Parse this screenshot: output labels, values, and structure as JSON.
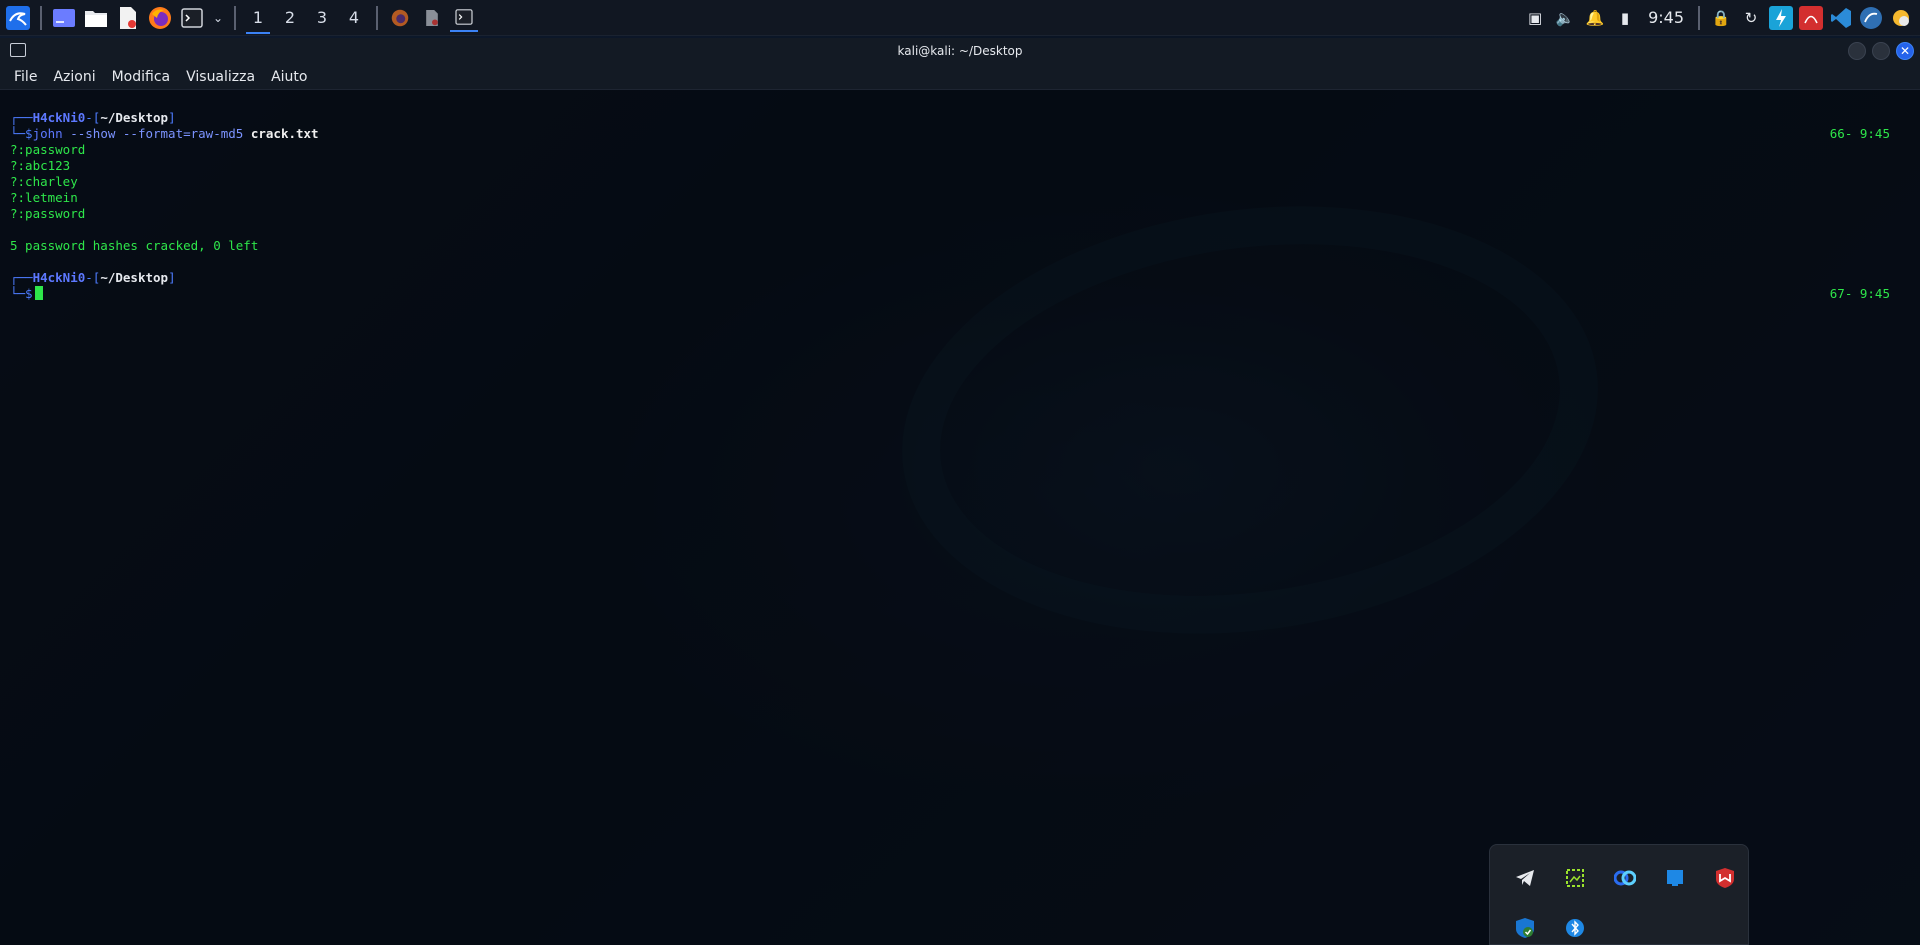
{
  "taskbar": {
    "workspaces": [
      "1",
      "2",
      "3",
      "4"
    ],
    "active_workspace": "1",
    "clock": "9:45",
    "icons_left": [
      "kali-menu-icon",
      "desktop-icon",
      "files-icon",
      "text-editor-icon",
      "firefox-icon",
      "terminal-icon",
      "dropdown-icon"
    ],
    "running_apps": [
      "firefox-icon",
      "text-editor-icon",
      "terminal-icon"
    ],
    "tray_icons": [
      "screen-icon",
      "volume-icon",
      "notifications-icon",
      "battery-icon",
      "lock-icon",
      "refresh-icon",
      "lightning-icon",
      "pdf-icon",
      "vscode-icon",
      "kali-dragon-icon",
      "weather-icon"
    ]
  },
  "window": {
    "title": "kali@kali: ~/Desktop"
  },
  "menu": {
    "file": "File",
    "azioni": "Azioni",
    "modifica": "Modifica",
    "visualizza": "Visualizza",
    "aiuto": "Aiuto"
  },
  "terminal": {
    "prompt1": {
      "corner": "┌──",
      "user": "H4ckNi0",
      "sep": "-[",
      "path": "~/Desktop",
      "close": "]",
      "arrow": "└─$",
      "command": "john",
      "flags": " --show --format=raw-md5 ",
      "arg": "crack.txt",
      "time": "66- 9:45"
    },
    "output": [
      "?:password",
      "?:abc123",
      "?:charley",
      "?:letmein",
      "?:password"
    ],
    "summary": "5 password hashes cracked, 0 left",
    "prompt2": {
      "corner": "┌──",
      "user": "H4ckNi0",
      "sep": "-[",
      "path": "~/Desktop",
      "close": "]",
      "arrow": "└─$",
      "time": "67- 9:45"
    }
  },
  "tray_popup": {
    "icons": [
      "telegram-icon",
      "screenshot-tool-icon",
      "webex-icon",
      "windows-app-icon",
      "mcafee-icon",
      "shield-check-icon",
      "bluetooth-icon"
    ]
  },
  "colors": {
    "accent": "#3b82f6",
    "terminal_green": "#2ee64a",
    "prompt_blue": "#5d78ff"
  }
}
